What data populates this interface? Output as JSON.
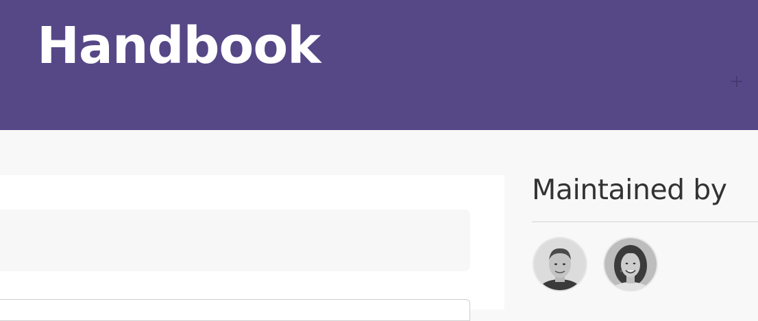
{
  "header": {
    "title": "Handbook",
    "background_color": "#564787",
    "add_icon": "plus-icon"
  },
  "sidebar": {
    "heading": "Maintained by",
    "maintainers": [
      {
        "avatar": "man-portrait-avatar"
      },
      {
        "avatar": "woman-portrait-avatar"
      }
    ]
  }
}
